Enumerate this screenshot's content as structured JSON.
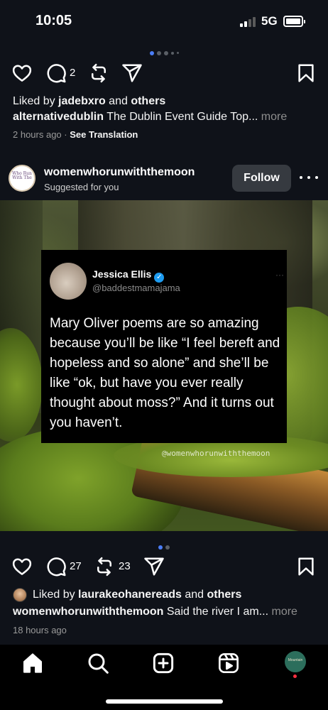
{
  "status_bar": {
    "time": "10:05",
    "network": "5G"
  },
  "previous_post": {
    "comment_count": "2",
    "likes_prefix": "Liked by ",
    "liker": "jadebxro",
    "likes_and": " and ",
    "likes_others": "others",
    "caption_user": "alternativedublin",
    "caption_text": " The Dublin Event Guide Top... ",
    "caption_more": "more",
    "timestamp": "2 hours ago",
    "separator": " · ",
    "see_translation": "See Translation"
  },
  "post": {
    "username": "womenwhorunwiththemoon",
    "subtitle": "Suggested for you",
    "follow_label": "Follow",
    "avatar_text": "Who Run With The",
    "tweet": {
      "name": "Jessica Ellis",
      "handle": "@baddestmamajama",
      "text": "Mary Oliver poems are so amazing because you’ll be like “I feel bereft and hopeless and so alone” and she’ll be like “ok, but have you ever really thought about moss?” And it turns out you haven’t.",
      "dots": "···"
    },
    "watermark": "@womenwhorunwiththemoon",
    "comment_count": "27",
    "repost_count": "23",
    "likes_prefix": "Liked by ",
    "liker": "laurakeohanereads",
    "likes_and": " and ",
    "likes_others": "others",
    "caption_user": "womenwhorunwiththemoon",
    "caption_text": " Said the river I am... ",
    "caption_more": "more",
    "timestamp": "18 hours ago"
  },
  "tabbar": {
    "profile_text": "Mountain"
  },
  "colors": {
    "background": "#0f1219",
    "accent": "#4a7df6",
    "follow_bg": "#363a40",
    "notification": "#ff3040"
  },
  "icons": [
    "heart-icon",
    "comment-icon",
    "repost-icon",
    "share-icon",
    "bookmark-icon",
    "home-icon",
    "search-icon",
    "create-icon",
    "reels-icon",
    "verified-icon"
  ]
}
